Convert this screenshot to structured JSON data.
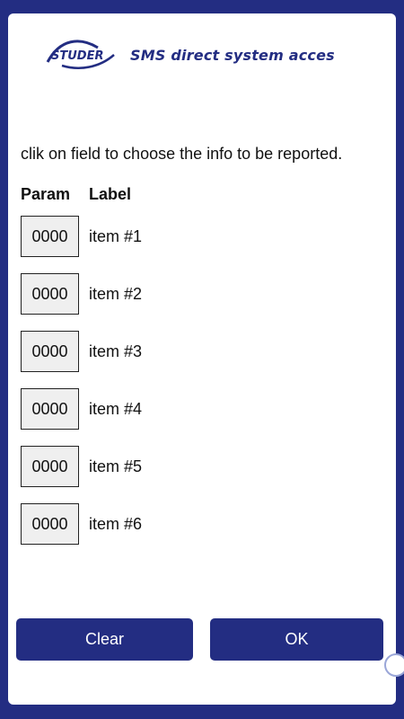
{
  "brand": {
    "logo_text": "STUDER",
    "title": "SMS direct system acces",
    "color": "#232d82"
  },
  "instruction": "clik on field to choose the info to be reported.",
  "table": {
    "param_header": "Param",
    "label_header": "Label",
    "rows": [
      {
        "param": "0000",
        "label": "item #1"
      },
      {
        "param": "0000",
        "label": "item #2"
      },
      {
        "param": "0000",
        "label": "item #3"
      },
      {
        "param": "0000",
        "label": "item #4"
      },
      {
        "param": "0000",
        "label": "item #5"
      },
      {
        "param": "0000",
        "label": "item #6"
      }
    ]
  },
  "buttons": {
    "clear_label": "Clear",
    "ok_label": "OK"
  },
  "icons": {
    "logo": "studer-logo-icon",
    "scroll": "scroll-handle-icon"
  }
}
